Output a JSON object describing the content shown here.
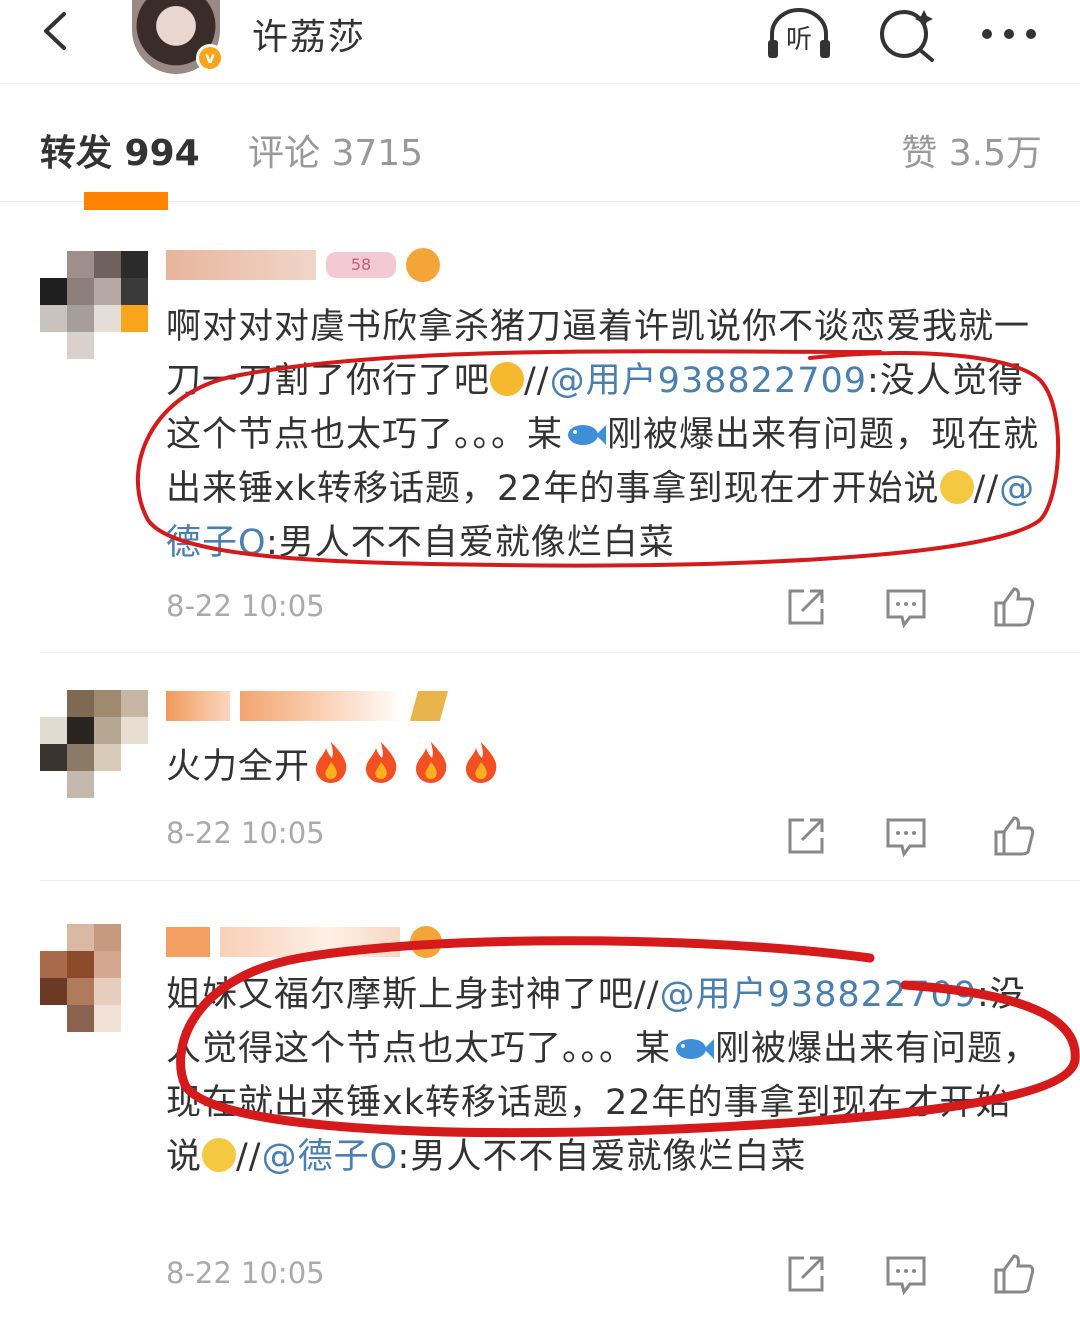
{
  "header": {
    "title": "许荔莎",
    "verified_mark": "v",
    "icons": [
      "back-arrow-icon",
      "listen-icon",
      "search-icon",
      "more-icon"
    ],
    "listen_label": "听"
  },
  "tabs": {
    "repost": "转发 994",
    "comment": "评论 3715",
    "like": "赞 3.5万",
    "active": "repost"
  },
  "posts": [
    {
      "level_badge": "58",
      "text_parts": [
        "啊对对对虞书欣拿杀猪刀逼着许凯说你不谈恋爱我就一刀一刀割了你行了吧",
        "//",
        "@用户938822709",
        ":没人觉得这个节点也太巧了。。。某",
        "刚被爆出来有问题，现在就出来锤xk转移话题，22年的事拿到现在才开始说",
        "//",
        "@德子O",
        ":男人不不自爱就像烂白菜"
      ],
      "time": "8-22 10:05"
    },
    {
      "text": "火力全开",
      "time": "8-22 10:05"
    },
    {
      "text_parts": [
        "姐妹又福尔摩斯上身封神了吧//",
        "@用户938822709",
        ":没人觉得这个节点也太巧了。。。某",
        "刚被爆出来有问题，现在就出来锤xk转移话题，22年的事拿到现在才开始说",
        "//",
        "@德子O",
        ":男人不不自爱就像烂白菜"
      ],
      "time": "8-22 10:05"
    }
  ],
  "colors": {
    "accent": "#ff8200",
    "mention": "#4a7fb0",
    "annotation_red": "#d41a1a",
    "muted": "#999999"
  }
}
